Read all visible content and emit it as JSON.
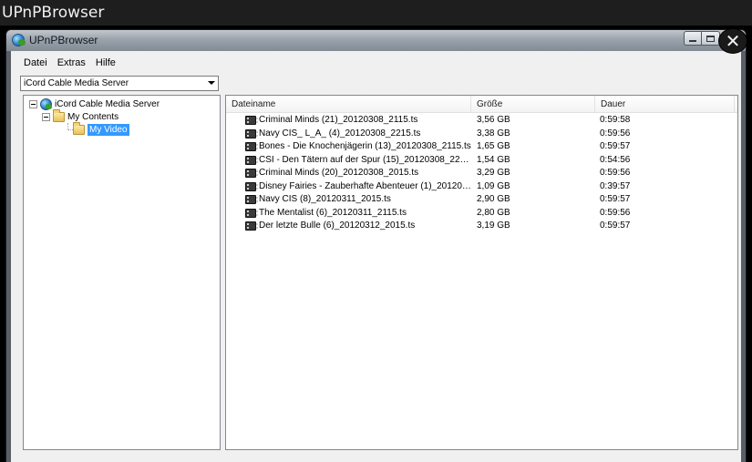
{
  "outer_title": "UPnPBrowser",
  "window": {
    "title": "UPnPBrowser",
    "close_glyph": "✕",
    "icon": "globe-icon"
  },
  "menu": {
    "items": [
      {
        "label": "Datei"
      },
      {
        "label": "Extras"
      },
      {
        "label": "Hilfe"
      }
    ]
  },
  "server_select": {
    "value": "iCord Cable Media Server"
  },
  "tree": {
    "root": {
      "label": "iCord Cable Media Server",
      "icon": "globe-icon"
    },
    "child": {
      "label": "My Contents",
      "icon": "folder-icon"
    },
    "grandchild": {
      "label": "My Video",
      "icon": "folder-icon",
      "selected": true
    }
  },
  "list": {
    "columns": {
      "name": "Dateiname",
      "size": "Größe",
      "duration": "Dauer"
    },
    "rows": [
      {
        "name": "Criminal Minds (21)_20120308_2115.ts",
        "size": "3,56 GB",
        "duration": "0:59:58"
      },
      {
        "name": "Navy CIS_ L_A_ (4)_20120308_2215.ts",
        "size": "3,38 GB",
        "duration": "0:59:56"
      },
      {
        "name": "Bones - Die Knochenjägerin (13)_20120308_2115.ts",
        "size": "1,65 GB",
        "duration": "0:59:57"
      },
      {
        "name": "CSI - Den Tätern auf der Spur (15)_20120308_2215.ts",
        "size": "1,54 GB",
        "duration": "0:54:56"
      },
      {
        "name": "Criminal Minds (20)_20120308_2015.ts",
        "size": "3,29 GB",
        "duration": "0:59:56"
      },
      {
        "name": "Disney Fairies - Zauberhafte Abenteuer (1)_20120310_...",
        "size": "1,09 GB",
        "duration": "0:39:57"
      },
      {
        "name": "Navy CIS (8)_20120311_2015.ts",
        "size": "2,90 GB",
        "duration": "0:59:57"
      },
      {
        "name": "The Mentalist (6)_20120311_2115.ts",
        "size": "2,80 GB",
        "duration": "0:59:56"
      },
      {
        "name": "Der letzte Bulle (6)_20120312_2015.ts",
        "size": "3,19 GB",
        "duration": "0:59:57"
      }
    ]
  },
  "colors": {
    "selection": "#3399ff",
    "outer_title_bg": "#1e1e1e"
  }
}
